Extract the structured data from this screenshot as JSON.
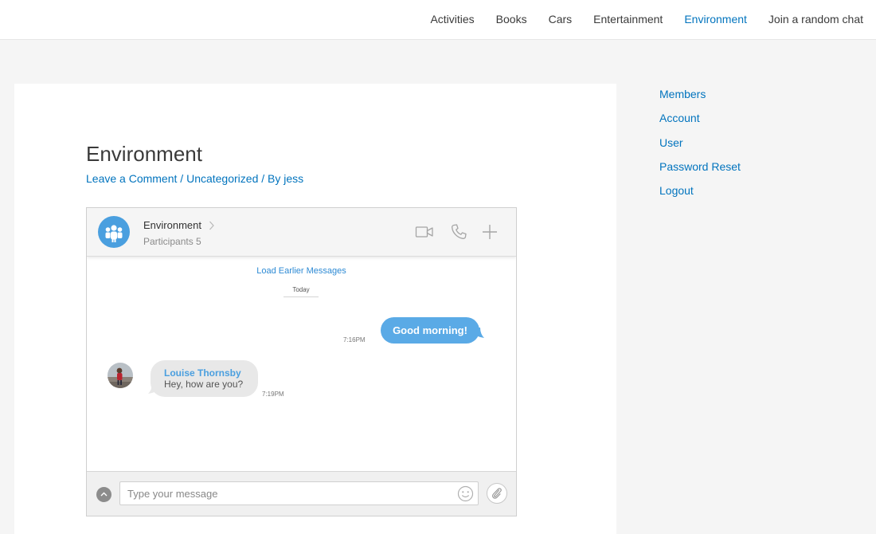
{
  "nav": {
    "items": [
      {
        "label": "Activities"
      },
      {
        "label": "Books"
      },
      {
        "label": "Cars"
      },
      {
        "label": "Entertainment"
      },
      {
        "label": "Environment",
        "active": true
      },
      {
        "label": "Join a random chat"
      }
    ]
  },
  "post": {
    "title": "Environment",
    "meta": {
      "comment": "Leave a Comment",
      "sep1": " / ",
      "category": "Uncategorized",
      "sep2": " / By ",
      "author": "jess"
    }
  },
  "chat": {
    "name": "Environment",
    "participants": "Participants 5",
    "load_earlier": "Load Earlier Messages",
    "day_label": "Today",
    "messages": [
      {
        "direction": "outgoing",
        "text": "Good morning!",
        "time": "7:16PM"
      },
      {
        "direction": "incoming",
        "sender": "Louise Thornsby",
        "text": "Hey, how are you?",
        "time": "7:19PM"
      }
    ],
    "input_placeholder": "Type your message",
    "header_icons": [
      "video-icon",
      "phone-icon",
      "plus-icon"
    ],
    "footer_icons": [
      "chevron-up-icon",
      "emoji-icon",
      "paperclip-icon"
    ]
  },
  "sidebar": {
    "links": [
      {
        "label": "Members"
      },
      {
        "label": "Account"
      },
      {
        "label": "User"
      },
      {
        "label": "Password Reset"
      },
      {
        "label": "Logout"
      }
    ]
  },
  "colors": {
    "link": "#0274be",
    "chat_accent": "#4a9fdf",
    "outgoing_bubble": "#5aaae6",
    "incoming_bubble": "#e8e8e8",
    "page_bg": "#f5f5f5"
  }
}
